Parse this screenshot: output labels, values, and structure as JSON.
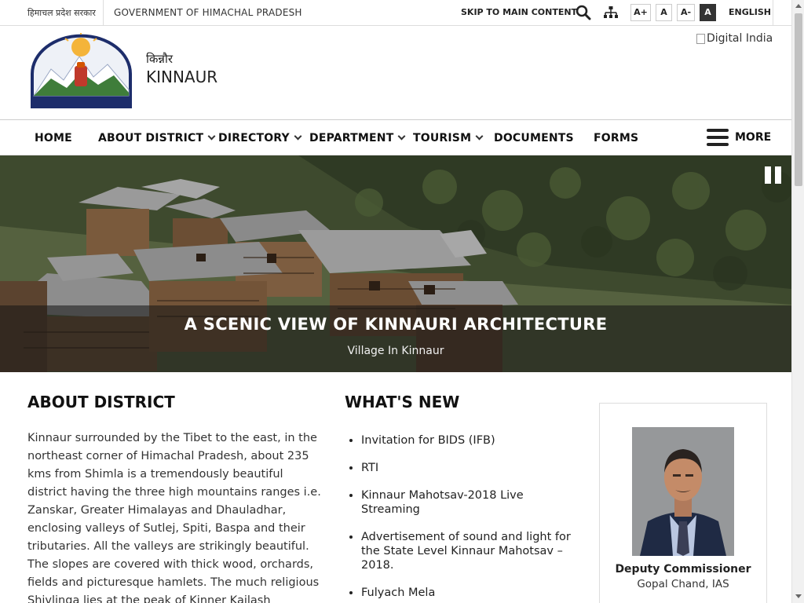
{
  "topbar": {
    "state_hindi": "हिमाचल प्रदेश सरकार",
    "government": "GOVERNMENT OF HIMACHAL PRADESH",
    "skip_link": "SKIP TO MAIN CONTENT",
    "search_icon": "search-icon",
    "sitemap_icon": "sitemap-icon",
    "font_increase": "A+",
    "font_normal": "A",
    "font_decrease": "A-",
    "contrast": "A",
    "language": "ENGLISH"
  },
  "header": {
    "emblem_text": "हिमाचल प्रदेश सरकार",
    "district_hindi": "किन्नौर",
    "district_name": "KINNAUR",
    "digital_india_alt": "Digital India"
  },
  "nav": {
    "items": [
      {
        "label": "HOME"
      },
      {
        "label": "ABOUT DISTRICT"
      },
      {
        "label": "DIRECTORY"
      },
      {
        "label": "DEPARTMENT"
      },
      {
        "label": "TOURISM"
      },
      {
        "label": "DOCUMENTS"
      },
      {
        "label": "FORMS"
      }
    ],
    "more_label": "MORE"
  },
  "hero": {
    "title": "A SCENIC VIEW OF KINNAURI ARCHITECTURE",
    "subtitle": "Village In Kinnaur"
  },
  "about": {
    "heading": "ABOUT DISTRICT",
    "text": "Kinnaur surrounded by the Tibet to the east, in the northeast corner of Himachal Pradesh, about 235 kms from Shimla is a tremendously beautiful district having the three high mountains ranges i.e. Zanskar, Greater Himalayas and Dhauladhar, enclosing valleys of Sutlej, Spiti, Baspa and their tributaries. All the valleys are strikingly beautiful. The slopes are covered with thick wood, orchards, fields and picturesque hamlets. The much religious Shivlinga lies at the peak of Kinner Kailash mountain."
  },
  "whats_new": {
    "heading": "WHAT'S NEW",
    "items": [
      "Invitation for BIDS (IFB)",
      "RTI",
      "Kinnaur Mahotsav-2018 Live Streaming",
      "Advertisement of sound and light for the State Level Kinnaur Mahotsav – 2018.",
      "Fulyach Mela"
    ]
  },
  "dc": {
    "title": "Deputy Commissioner",
    "name": "Gopal Chand, IAS"
  }
}
